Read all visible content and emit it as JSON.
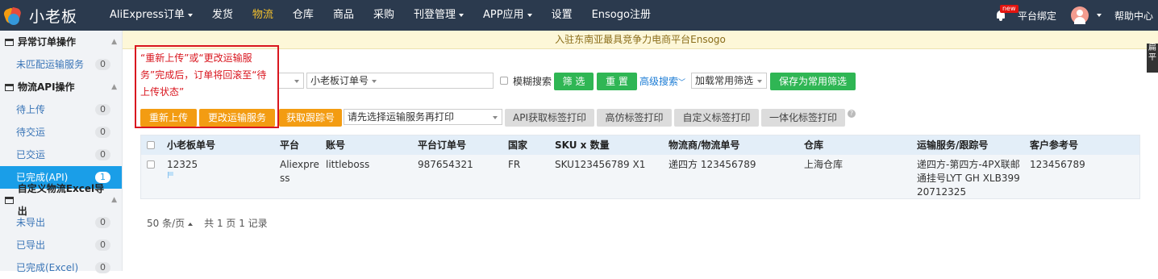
{
  "header": {
    "logo_text": "小老板",
    "nav": [
      {
        "label": "AliExpress订单",
        "dropdown": true
      },
      {
        "label": "发货",
        "dropdown": false
      },
      {
        "label": "物流",
        "dropdown": false,
        "active": true
      },
      {
        "label": "仓库",
        "dropdown": false
      },
      {
        "label": "商品",
        "dropdown": false
      },
      {
        "label": "采购",
        "dropdown": false
      },
      {
        "label": "刊登管理",
        "dropdown": true
      },
      {
        "label": "APP应用",
        "dropdown": true
      },
      {
        "label": "设置",
        "dropdown": false
      },
      {
        "label": "Ensogo注册",
        "dropdown": false
      }
    ],
    "new_badge": "new",
    "platform_bind": "平台绑定",
    "help": "帮助中心"
  },
  "sidebar": {
    "groups": [
      {
        "title": "异常订单操作",
        "items": [
          {
            "label": "未匹配运输服务",
            "count": "0"
          }
        ]
      },
      {
        "title": "物流API操作",
        "items": [
          {
            "label": "待上传",
            "count": "0"
          },
          {
            "label": "待交运",
            "count": "0"
          },
          {
            "label": "已交运",
            "count": "0"
          },
          {
            "label": "已完成(API)",
            "count": "1",
            "active": true
          }
        ]
      },
      {
        "title": "自定义物流Excel导出",
        "items": [
          {
            "label": "未导出",
            "count": "0"
          },
          {
            "label": "已导出",
            "count": "0"
          },
          {
            "label": "已完成(Excel)",
            "count": "0"
          }
        ]
      }
    ]
  },
  "notice": "入驻东南亚最具竞争力电商平台Ensogo",
  "side_float": "扁平",
  "annotation": "“重新上传”或“更改运输服务”完成后，订单将回滚至“待上传状态”",
  "filters": {
    "order_type_select": "小老板订单号",
    "fuzzy_search_label": "模糊搜索",
    "search_button": "筛 选",
    "reset_button": "重 置",
    "advanced_search": "高级搜索",
    "load_filter_select": "加载常用筛选",
    "save_filter_button": "保存为常用筛选"
  },
  "actions": {
    "reupload": "重新上传",
    "change_service": "更改运输服务",
    "get_tracking": "获取跟踪号",
    "print_select": "请先选择运输服务再打印",
    "api_label": "API获取标签打印",
    "high_sim_label": "高仿标签打印",
    "custom_label": "自定义标签打印",
    "integrated_label": "一体化标签打印",
    "help_mark": "?"
  },
  "table": {
    "columns": [
      "小老板单号",
      "平台",
      "账号",
      "平台订单号",
      "国家",
      "SKU x 数量",
      "物流商/物流单号",
      "仓库",
      "运输服务/跟踪号",
      "客户参考号"
    ],
    "rows": [
      {
        "order_no": "12325",
        "platform": "Aliexpress",
        "account": "littleboss",
        "platform_order": "987654321",
        "country": "FR",
        "sku_qty": "SKU123456789 X1",
        "carrier": "递四方 123456789",
        "warehouse": "上海仓库",
        "service": "递四方-第四方-4PX联邮通挂号LYT GH XLB39920712325",
        "customer_ref": "123456789"
      }
    ]
  },
  "pager": {
    "per_page": "50 条/页",
    "summary": "共 1 页 1 记录"
  }
}
